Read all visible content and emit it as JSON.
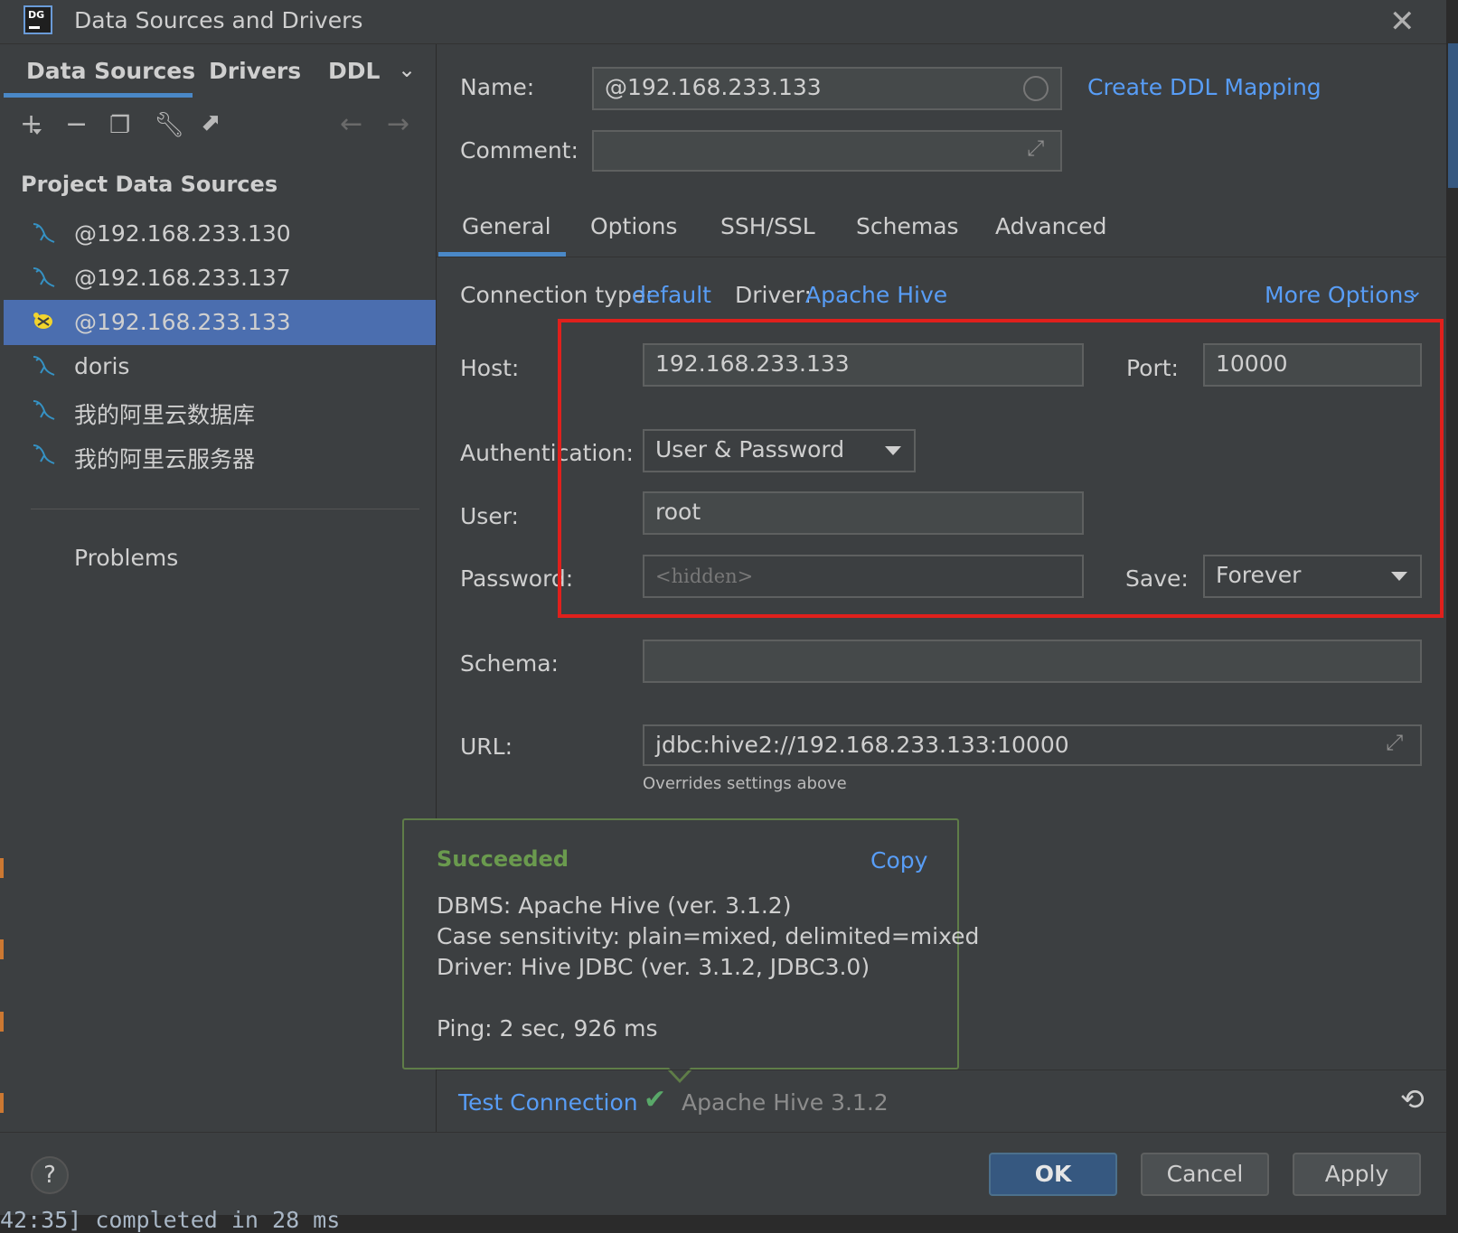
{
  "window": {
    "title": "Data Sources and Drivers",
    "app_icon_text": "DG"
  },
  "left": {
    "tabs": [
      "Data Sources",
      "Drivers",
      "DDL"
    ],
    "group_title": "Project Data Sources",
    "items": [
      {
        "label": "@192.168.233.130",
        "icon": "mysql-dolphin-icon"
      },
      {
        "label": "@192.168.233.137",
        "icon": "mysql-dolphin-icon"
      },
      {
        "label": "@192.168.233.133",
        "icon": "hive-bee-icon",
        "selected": true
      },
      {
        "label": "doris",
        "icon": "mysql-dolphin-icon"
      },
      {
        "label": "我的阿里云数据库",
        "icon": "mysql-dolphin-icon"
      },
      {
        "label": "我的阿里云服务器",
        "icon": "mysql-dolphin-icon"
      }
    ],
    "problems": "Problems"
  },
  "form": {
    "name_label": "Name:",
    "name_value": "@192.168.233.133",
    "create_ddl": "Create DDL Mapping",
    "comment_label": "Comment:",
    "comment_value": "",
    "tabs": [
      "General",
      "Options",
      "SSH/SSL",
      "Schemas",
      "Advanced"
    ],
    "connection_type_label": "Connection type:",
    "connection_type_value": "default",
    "driver_label": "Driver:",
    "driver_value": "Apache Hive",
    "more_options": "More Options",
    "host_label": "Host:",
    "host_value": "192.168.233.133",
    "port_label": "Port:",
    "port_value": "10000",
    "auth_label": "Authentication:",
    "auth_value": "User & Password",
    "user_label": "User:",
    "user_value": "root",
    "password_label": "Password:",
    "password_placeholder": "<hidden>",
    "save_label": "Save:",
    "save_value": "Forever",
    "schema_label": "Schema:",
    "schema_value": "",
    "url_label": "URL:",
    "url_value": "jdbc:hive2://192.168.233.133:10000",
    "url_hint": "Overrides settings above"
  },
  "popup": {
    "status": "Succeeded",
    "copy": "Copy",
    "dbms": "DBMS: Apache Hive (ver. 3.1.2)",
    "case": "Case sensitivity: plain=mixed, delimited=mixed",
    "driver": "Driver: Hive JDBC (ver. 3.1.2, JDBC3.0)",
    "ping": "Ping: 2 sec, 926 ms"
  },
  "test": {
    "link": "Test Connection",
    "result": "Apache Hive 3.1.2"
  },
  "buttons": {
    "ok": "OK",
    "cancel": "Cancel",
    "apply": "Apply"
  },
  "console": {
    "text": "42:35] completed in 28 ms"
  },
  "colors": {
    "accent": "#589df6",
    "selection": "#4b6eaf",
    "success": "#6a9a4e",
    "highlight_box": "#e0201c"
  }
}
